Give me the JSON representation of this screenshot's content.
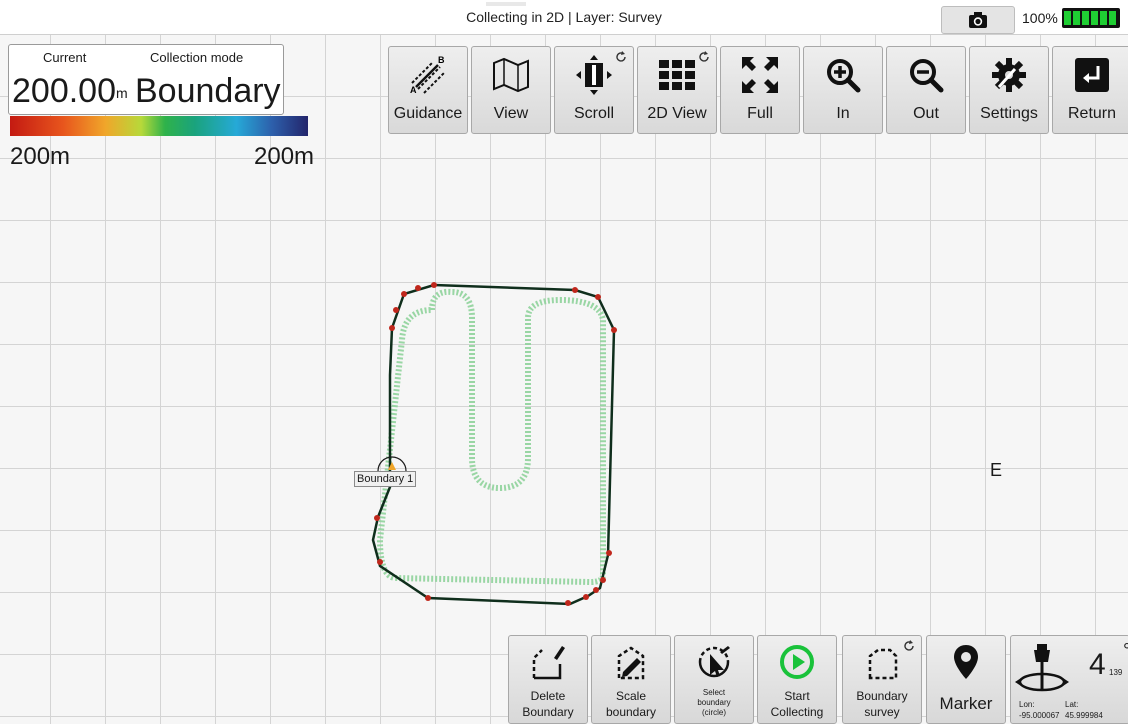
{
  "title": "Collecting in 2D | Layer: Survey",
  "battery": {
    "percent_label": "100%",
    "level": 1.0,
    "color": "#1fce33"
  },
  "info": {
    "current_label": "Current",
    "mode_label": "Collection mode",
    "current_value": "200.00",
    "current_unit": "m",
    "mode_value": "Boundary",
    "scale_min": "200m",
    "scale_max": "200m"
  },
  "toolbar": [
    {
      "name": "guidance",
      "label": "Guidance",
      "icon": "guidance-ab-icon"
    },
    {
      "name": "view",
      "label": "View",
      "icon": "map-icon"
    },
    {
      "name": "scroll",
      "label": "Scroll",
      "icon": "scroll-icon"
    },
    {
      "name": "2d-view",
      "label": "2D View",
      "icon": "grid-icon"
    },
    {
      "name": "full",
      "label": "Full",
      "icon": "fullscreen-icon"
    },
    {
      "name": "zoom-in",
      "label": "In",
      "icon": "zoom-in-icon"
    },
    {
      "name": "zoom-out",
      "label": "Out",
      "icon": "zoom-out-icon"
    },
    {
      "name": "settings",
      "label": "Settings",
      "icon": "gear-icon"
    },
    {
      "name": "return",
      "label": "Return",
      "icon": "return-icon"
    }
  ],
  "bottom": {
    "delete": "Delete\nBoundary",
    "scale": "Scale\nboundary",
    "select": "Select\nboundary\n(circle)",
    "start": "Start\nCollecting",
    "survey": "Boundary\nsurvey",
    "marker": "Marker"
  },
  "gps": {
    "satellites": "4",
    "satellites_sub": "139",
    "degree": "°",
    "lon_label": "Lon:",
    "lat_label": "Lat:",
    "lon_value": "-95.000067",
    "lat_value": "45.999984"
  },
  "map": {
    "compass": "E",
    "boundary_label": "Boundary 1"
  },
  "colors": {
    "boundary_line": "#0f2e1c",
    "boundary_points": "#c0271c",
    "survey_path": "#8fd39b",
    "start_green": "#19c23a"
  }
}
